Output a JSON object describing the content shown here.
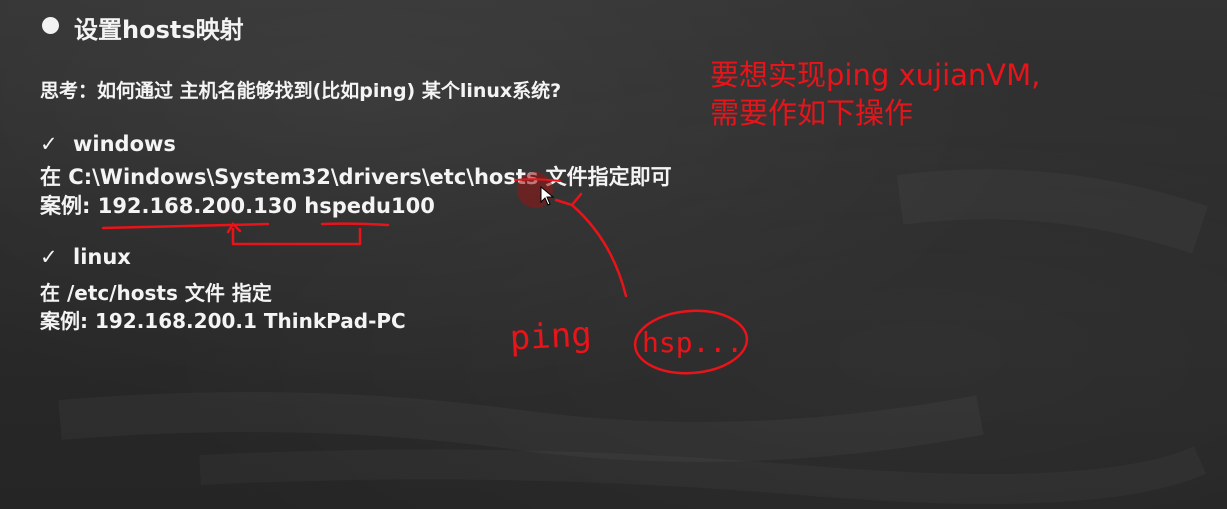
{
  "slide": {
    "title": "设置hosts映射",
    "question": "思考：如何通过 主机名能够找到(比如ping) 某个linux系统?",
    "windows": {
      "heading": "windows",
      "path_line": "在 C:\\Windows\\System32\\drivers\\etc\\hosts 文件指定即可",
      "example_line": "案例: 192.168.200.130 hspedu100"
    },
    "linux": {
      "heading": "linux",
      "path_line": "在 /etc/hosts 文件 指定",
      "example_line": "案例: 192.168.200.1 ThinkPad-PC"
    },
    "check_mark": "✓"
  },
  "annotations": {
    "note_line_1": "要想实现ping xujianVM,",
    "note_line_2": "需要作如下操作",
    "hand_ping": "ping",
    "hand_host": "hsp...",
    "annotation_color": "#e8141a"
  },
  "theme": {
    "board_color": "#2b2b2b",
    "text_color": "#f4f4f4"
  }
}
